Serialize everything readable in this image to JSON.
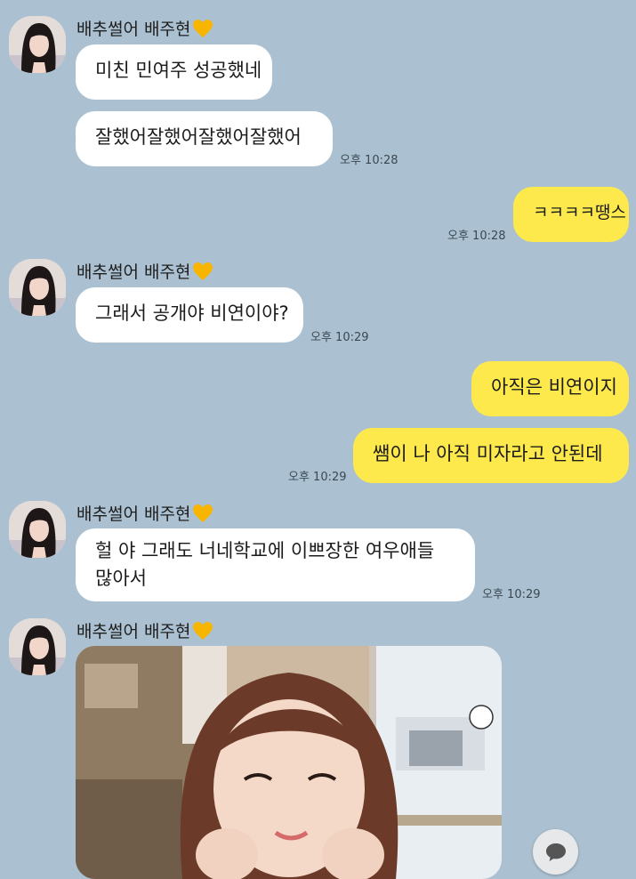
{
  "chat": {
    "groups": [
      {
        "sender": "배추썰어 배주현",
        "messages": [
          {
            "text": "미친 민여주 성공했네"
          },
          {
            "text": "잘했어잘했어잘했어잘했어",
            "time": "오후 10:28"
          }
        ]
      },
      {
        "sender": "배추썰어 배주현",
        "messages": [
          {
            "text": "그래서 공개야 비연이야?",
            "time": "오후 10:29"
          }
        ]
      },
      {
        "sender": "배추썰어 배주현",
        "messages": [
          {
            "text": "헐 야 그래도 너네학교에 이쁘장한 여우애들",
            "text2": "많아서",
            "time": "오후 10:29"
          }
        ]
      },
      {
        "sender": "배추썰어 배주현",
        "messages": []
      }
    ],
    "outgoing": [
      {
        "text": "ㅋㅋㅋㅋ땡스",
        "time": "오후 10:28"
      },
      {
        "text": "아직은 비연이지"
      },
      {
        "text": "쌤이 나 아직 미자라고 안된데",
        "time": "오후 10:29"
      }
    ]
  },
  "colors": {
    "background": "#abc1d1",
    "incoming_bubble": "#ffffff",
    "outgoing_bubble": "#fee94c",
    "heart": "#f7b500"
  },
  "icons": {
    "sender_badge": "yellow-heart-icon",
    "floating_button": "chat-bubble-icon"
  }
}
